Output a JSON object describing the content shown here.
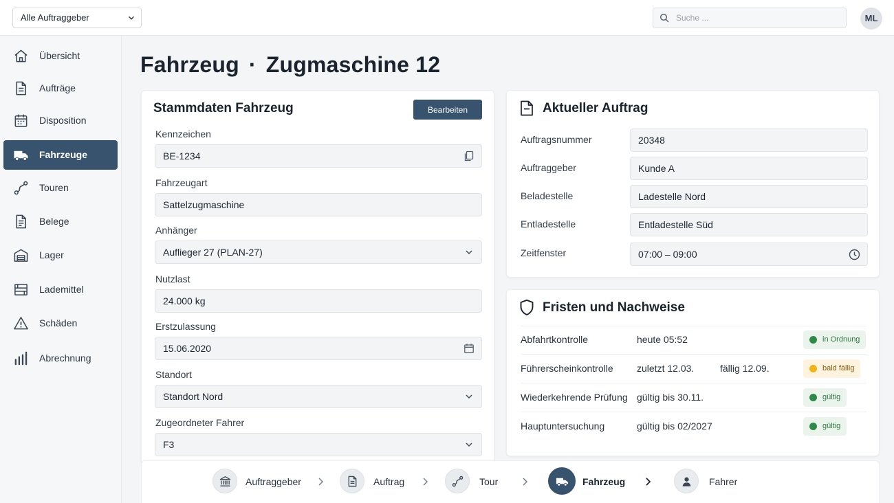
{
  "topbar": {
    "client_select": "Alle Auftraggeber",
    "search_placeholder": "Suche ...",
    "avatar_initials": "ML"
  },
  "sidebar": {
    "items": [
      {
        "label": "Übersicht",
        "icon": "home-icon"
      },
      {
        "label": "Aufträge",
        "icon": "document-icon"
      },
      {
        "label": "Disposition",
        "icon": "calendar-icon"
      },
      {
        "label": "Fahrzeuge",
        "icon": "truck-icon",
        "active": true
      },
      {
        "label": "Touren",
        "icon": "route-icon"
      },
      {
        "label": "Belege",
        "icon": "receipt-icon"
      },
      {
        "label": "Lager",
        "icon": "warehouse-icon"
      },
      {
        "label": "Lademittel",
        "icon": "pallet-icon"
      },
      {
        "label": "Schäden",
        "icon": "warning-icon"
      },
      {
        "label": "Abrechnung",
        "icon": "bar-chart-icon"
      }
    ]
  },
  "page": {
    "title_main": "Fahrzeug",
    "title_sep": "·",
    "title_sub": "Zugmaschine 12"
  },
  "master": {
    "title": "Stammdaten Fahrzeug",
    "edit_label": "Bearbeiten",
    "fields": [
      {
        "label": "Kennzeichen",
        "value": "BE-1234",
        "icon": "copy-icon"
      },
      {
        "label": "Fahrzeugart",
        "value": "Sattelzugmaschine"
      },
      {
        "label": "Anhänger",
        "value": "Auflieger 27 (PLAN-27)",
        "icon": "chevron-down-icon"
      },
      {
        "label": "Nutzlast",
        "value": "24.000 kg"
      },
      {
        "label": "Erstzulassung",
        "value": "15.06.2020",
        "icon": "calendar-icon"
      },
      {
        "label": "Standort",
        "value": "Standort Nord",
        "icon": "chevron-down-icon"
      },
      {
        "label": "Zugeordneter Fahrer",
        "value": "F3",
        "icon": "chevron-down-icon"
      }
    ]
  },
  "order": {
    "title": "Aktueller Auftrag",
    "fields": [
      {
        "label": "Auftragsnummer",
        "value": "20348"
      },
      {
        "label": "Auftraggeber",
        "value": "Kunde A"
      },
      {
        "label": "Beladestelle",
        "value": "Ladestelle Nord"
      },
      {
        "label": "Entladestelle",
        "value": "Entladestelle Süd"
      },
      {
        "label": "Zeitfenster",
        "value": "07:00 – 09:00",
        "icon": "clock-icon"
      }
    ]
  },
  "deadlines": {
    "title": "Fristen und Nachweise",
    "rows": [
      {
        "name": "Abfahrtkontrolle",
        "info": "heute 05:52",
        "due": "",
        "status": "in Ordnung",
        "state": "ok"
      },
      {
        "name": "Führerscheinkontrolle",
        "info": "zuletzt 12.03.",
        "due": "fällig 12.09.",
        "status": "bald fällig",
        "state": "warn"
      },
      {
        "name": "Wiederkehrende Prüfung",
        "info": "gültig bis 30.11.",
        "due": "",
        "status": "gültig",
        "state": "ok"
      },
      {
        "name": "Hauptuntersuchung",
        "info": "gültig bis 02/2027",
        "due": "",
        "status": "gültig",
        "state": "ok"
      }
    ]
  },
  "path": {
    "steps": [
      {
        "label": "Auftraggeber",
        "icon": "bank-icon"
      },
      {
        "label": "Auftrag",
        "icon": "document-icon"
      },
      {
        "label": "Tour",
        "icon": "route-icon"
      },
      {
        "label": "Fahrzeug",
        "icon": "truck-icon",
        "active": true
      },
      {
        "label": "Fahrer",
        "icon": "person-icon"
      }
    ]
  },
  "colors": {
    "primary": "#38536d",
    "ok": "#2e8a47",
    "warn": "#f0b416"
  }
}
